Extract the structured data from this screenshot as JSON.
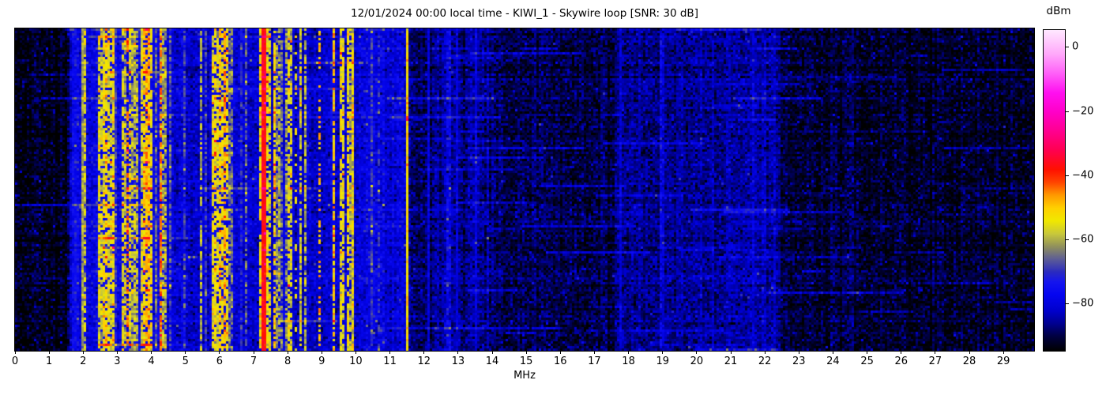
{
  "chart_data": {
    "type": "heatmap",
    "subtype": "radio-spectrogram-waterfall",
    "title": "12/01/2024 00:00 local time - KIWI_1 - Skywire loop [SNR: 30 dB]",
    "xlabel": "MHz",
    "xlim": [
      0,
      29.9
    ],
    "xticks": [
      0,
      1,
      2,
      3,
      4,
      5,
      6,
      7,
      8,
      9,
      10,
      11,
      12,
      13,
      14,
      15,
      16,
      17,
      18,
      19,
      20,
      21,
      22,
      23,
      24,
      25,
      26,
      27,
      28,
      29
    ],
    "grid": false,
    "colorbar": {
      "label": "dBm",
      "ticks": [
        0,
        -20,
        -40,
        -60,
        -80
      ],
      "tick_labels": [
        "0",
        "−20",
        "−40",
        "−60",
        "−80"
      ],
      "vmin": -94.5,
      "vmax": 5.5,
      "position": "right",
      "stops": [
        [
          -94.5,
          "#000000"
        ],
        [
          -90,
          "#000040"
        ],
        [
          -86,
          "#000090"
        ],
        [
          -82,
          "#0000cc"
        ],
        [
          -77,
          "#0505f0"
        ],
        [
          -73,
          "#1515ee"
        ],
        [
          -70,
          "#2a2ac0"
        ],
        [
          -66,
          "#5c5c96"
        ],
        [
          -62,
          "#90905c"
        ],
        [
          -58,
          "#c8c83a"
        ],
        [
          -54,
          "#f0e800"
        ],
        [
          -50,
          "#ffd000"
        ],
        [
          -46,
          "#ff9900"
        ],
        [
          -42,
          "#ff4400"
        ],
        [
          -38,
          "#ff1000"
        ],
        [
          -32,
          "#ff0050"
        ],
        [
          -26,
          "#ff0090"
        ],
        [
          -20,
          "#ff00c8"
        ],
        [
          -14,
          "#ff10f0"
        ],
        [
          -8,
          "#ff60f8"
        ],
        [
          -2,
          "#ffa8fa"
        ],
        [
          5.5,
          "#ffe8ff"
        ]
      ]
    },
    "noise_floor_dbm": [
      [
        0,
        -92.5
      ],
      [
        1.5,
        -92.5
      ],
      [
        1.58,
        -86
      ],
      [
        1.62,
        -80
      ],
      [
        1.9,
        -78.5
      ],
      [
        2.1,
        -78
      ],
      [
        4.6,
        -79
      ],
      [
        5.2,
        -81
      ],
      [
        5.65,
        -81
      ],
      [
        5.75,
        -80
      ],
      [
        8.5,
        -81.5
      ],
      [
        9.3,
        -82
      ],
      [
        9.95,
        -80.5
      ],
      [
        10.1,
        -79.5
      ],
      [
        11.35,
        -79.5
      ],
      [
        11.55,
        -83
      ],
      [
        11.65,
        -88
      ],
      [
        12.25,
        -87.5
      ],
      [
        12.35,
        -84.5
      ],
      [
        13.8,
        -85.5
      ],
      [
        14.3,
        -89.5
      ],
      [
        17.4,
        -89.5
      ],
      [
        17.8,
        -86
      ],
      [
        20.3,
        -85
      ],
      [
        22.3,
        -84
      ],
      [
        22.7,
        -91
      ],
      [
        26,
        -91.5
      ],
      [
        29.9,
        -92
      ]
    ],
    "signal_bands": [
      {
        "f0": 1.58,
        "f1": 1.88,
        "density": 0.8,
        "min_dbm": -78,
        "max_dbm": -70
      },
      {
        "f0": 1.95,
        "f1": 2.32,
        "density": 0.5,
        "min_dbm": -70,
        "max_dbm": -54
      },
      {
        "f0": 2.4,
        "f1": 2.9,
        "density": 0.75,
        "min_dbm": -63,
        "max_dbm": -48
      },
      {
        "f0": 2.9,
        "f1": 3.1,
        "density": 0.35,
        "min_dbm": -72,
        "max_dbm": -58
      },
      {
        "f0": 3.1,
        "f1": 3.5,
        "density": 0.7,
        "min_dbm": -62,
        "max_dbm": -46
      },
      {
        "f0": 3.5,
        "f1": 3.76,
        "density": 0.5,
        "min_dbm": -68,
        "max_dbm": -54
      },
      {
        "f0": 3.76,
        "f1": 4.05,
        "density": 0.7,
        "min_dbm": -60,
        "max_dbm": -46
      },
      {
        "f0": 4.05,
        "f1": 4.42,
        "density": 0.55,
        "min_dbm": -66,
        "max_dbm": -50
      },
      {
        "f0": 4.42,
        "f1": 4.8,
        "density": 0.4,
        "min_dbm": -72,
        "max_dbm": -56
      },
      {
        "f0": 4.8,
        "f1": 5.78,
        "density": 0.25,
        "min_dbm": -74,
        "max_dbm": -58
      },
      {
        "f0": 5.78,
        "f1": 6.28,
        "density": 0.72,
        "min_dbm": -60,
        "max_dbm": -47
      },
      {
        "f0": 6.28,
        "f1": 7.0,
        "density": 0.28,
        "min_dbm": -73,
        "max_dbm": -58
      },
      {
        "f0": 7.0,
        "f1": 7.68,
        "density": 0.78,
        "min_dbm": -58,
        "max_dbm": -44
      },
      {
        "f0": 7.68,
        "f1": 8.15,
        "density": 0.5,
        "min_dbm": -66,
        "max_dbm": -50
      },
      {
        "f0": 8.28,
        "f1": 8.6,
        "density": 0.55,
        "min_dbm": -64,
        "max_dbm": -52
      },
      {
        "f0": 9.35,
        "f1": 9.95,
        "density": 0.6,
        "min_dbm": -63,
        "max_dbm": -50
      },
      {
        "f0": 10.15,
        "f1": 11.4,
        "density": 0.18,
        "min_dbm": -75,
        "max_dbm": -64
      },
      {
        "f0": 12.35,
        "f1": 13.85,
        "density": 0.12,
        "min_dbm": -82,
        "max_dbm": -76
      },
      {
        "f0": 17.6,
        "f1": 22.2,
        "density": 0.08,
        "min_dbm": -82,
        "max_dbm": -77
      }
    ],
    "carriers": [
      {
        "mhz": 1.98,
        "dbm": -61,
        "style": "solid",
        "duty": 1,
        "width": 1
      },
      {
        "mhz": 3.25,
        "dbm": -45,
        "style": "dashed",
        "duty": 0.5,
        "width": 1
      },
      {
        "mhz": 4.21,
        "dbm": -44,
        "style": "dashed",
        "duty": 0.6,
        "width": 1
      },
      {
        "mhz": 7.25,
        "dbm": -36,
        "style": "solid",
        "duty": 1,
        "width": 2
      },
      {
        "mhz": 8.18,
        "dbm": -53,
        "style": "dashed",
        "duty": 0.2,
        "width": 1
      },
      {
        "mhz": 8.9,
        "dbm": -48,
        "style": "dashed",
        "duty": 0.45,
        "width": 1
      },
      {
        "mhz": 9.9,
        "dbm": -62,
        "style": "solid",
        "duty": 1,
        "width": 1
      },
      {
        "mhz": 10.65,
        "dbm": -69,
        "style": "dashed",
        "duty": 0.35,
        "width": 1
      },
      {
        "mhz": 11.5,
        "dbm": -52,
        "style": "solid",
        "duty": 1,
        "width": 1
      },
      {
        "mhz": 12.1,
        "dbm": -80,
        "style": "solid",
        "duty": 1,
        "width": 1
      },
      {
        "mhz": 12.9,
        "dbm": -80,
        "style": "solid",
        "duty": 1,
        "width": 1
      },
      {
        "mhz": 13.5,
        "dbm": -79,
        "style": "solid",
        "duty": 1,
        "width": 1
      },
      {
        "mhz": 17.7,
        "dbm": -81,
        "style": "solid",
        "duty": 1,
        "width": 1
      }
    ],
    "render": {
      "seed": 1337,
      "cols": 430,
      "rows": 136,
      "noise_sigma": 3.2,
      "row_sigma": 1.0,
      "col_sigma": 1.2,
      "sparkle_prob": 0.012,
      "streaks": {
        "count": 120,
        "min_boost": 3,
        "max_boost": 10,
        "min_len_mhz": 0.2,
        "max_len_mhz": 4.0
      }
    }
  }
}
